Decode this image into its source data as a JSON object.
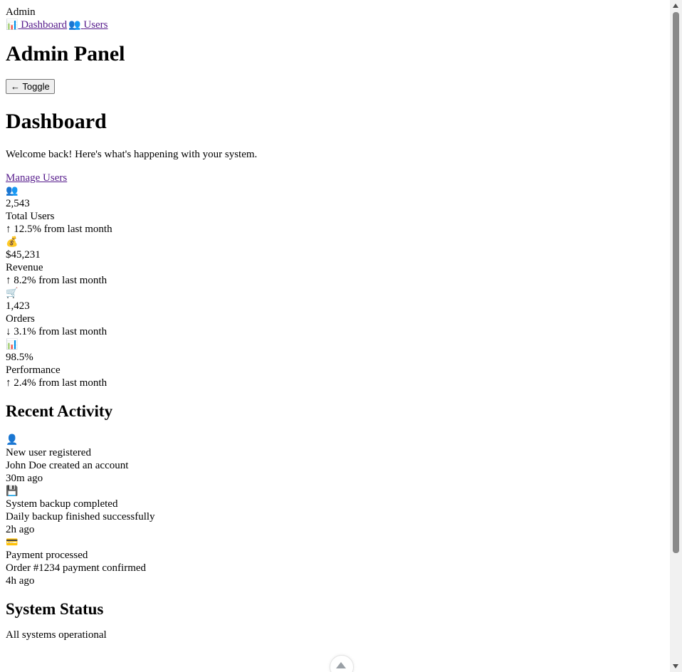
{
  "sidebar": {
    "brand": "Admin",
    "nav": [
      {
        "icon": "📊",
        "label": "Dashboard"
      },
      {
        "icon": "👥",
        "label": "Users"
      }
    ]
  },
  "header": {
    "title": "Admin Panel",
    "toggle_label": "← Toggle"
  },
  "main": {
    "heading": "Dashboard",
    "welcome": "Welcome back! Here's what's happening with your system.",
    "manage_users_link": "Manage Users",
    "stats": [
      {
        "icon": "👥",
        "value": "2,543",
        "label": "Total Users",
        "change": "↑ 12.5% from last month"
      },
      {
        "icon": "💰",
        "value": "$45,231",
        "label": "Revenue",
        "change": "↑ 8.2% from last month"
      },
      {
        "icon": "🛒",
        "value": "1,423",
        "label": "Orders",
        "change": "↓ 3.1% from last month"
      },
      {
        "icon": "📊",
        "value": "98.5%",
        "label": "Performance",
        "change": "↑ 2.4% from last month"
      }
    ],
    "recent_activity": {
      "heading": "Recent Activity",
      "items": [
        {
          "icon": "👤",
          "title": "New user registered",
          "description": "John Doe created an account",
          "time": "30m ago"
        },
        {
          "icon": "💾",
          "title": "System backup completed",
          "description": "Daily backup finished successfully",
          "time": "2h ago"
        },
        {
          "icon": "💳",
          "title": "Payment processed",
          "description": "Order #1234 payment confirmed",
          "time": "4h ago"
        }
      ]
    },
    "system_status": {
      "heading": "System Status",
      "text": "All systems operational"
    }
  },
  "colors": {
    "link": "#551a8b",
    "text": "#000000",
    "background": "#ffffff"
  }
}
